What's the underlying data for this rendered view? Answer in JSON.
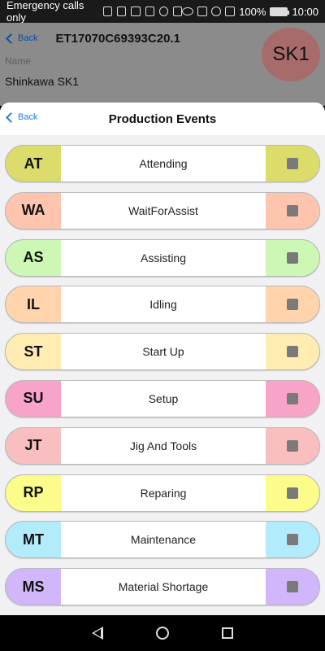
{
  "status_bar": {
    "carrier": "Emergency calls only",
    "battery": "100%",
    "time": "10:00"
  },
  "background_page": {
    "back_label": "Back",
    "title": "ET17070C69393C20.1",
    "badge": "SK1",
    "field_label": "Name",
    "field_value": "Shinkawa SK1"
  },
  "sheet": {
    "back_label": "Back",
    "title": "Production Events"
  },
  "events": [
    {
      "code": "AT",
      "label": "Attending",
      "color": "#dcdc6b"
    },
    {
      "code": "WA",
      "label": "WaitForAssist",
      "color": "#ffc4ad"
    },
    {
      "code": "AS",
      "label": "Assisting",
      "color": "#ccf7b4"
    },
    {
      "code": "IL",
      "label": "Idling",
      "color": "#ffd4ac"
    },
    {
      "code": "ST",
      "label": "Start Up",
      "color": "#ffecb1"
    },
    {
      "code": "SU",
      "label": "Setup",
      "color": "#f8a4c8"
    },
    {
      "code": "JT",
      "label": "Jig And Tools",
      "color": "#f9bfc0"
    },
    {
      "code": "RP",
      "label": "Reparing",
      "color": "#fbfc8a"
    },
    {
      "code": "MT",
      "label": "Maintenance",
      "color": "#b2ebfb"
    },
    {
      "code": "MS",
      "label": "Material Shortage",
      "color": "#d1b6fb"
    }
  ]
}
